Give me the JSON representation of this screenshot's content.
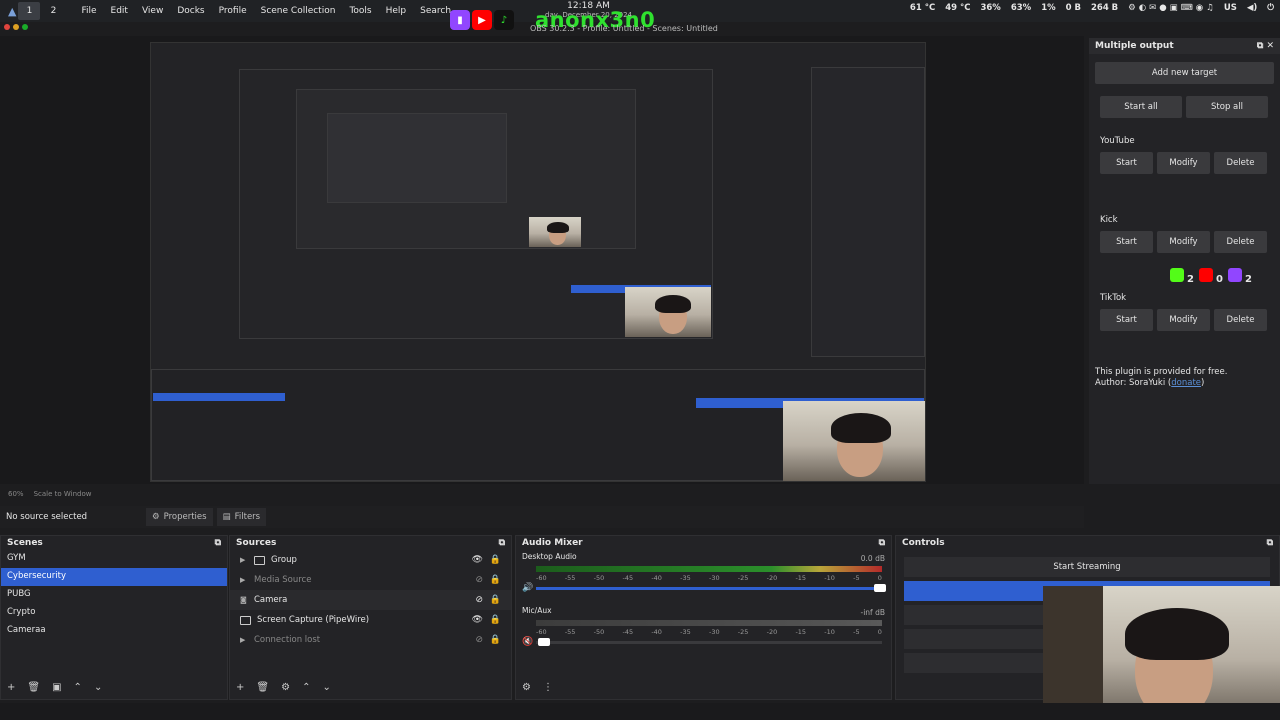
{
  "taskbar": {
    "workspaces": [
      "1",
      "2"
    ],
    "active_workspace": "1",
    "menu": [
      "File",
      "Edit",
      "View",
      "Docks",
      "Profile",
      "Scene Collection",
      "Tools",
      "Help",
      "Search"
    ],
    "clock_time": "12:18 AM",
    "clock_date": "day, December 20, 2024",
    "channel_name": "anonx3n0",
    "window_title": "OBS 30.2.3 - Profile: Untitled - Scenes: Untitled",
    "tray": [
      "61 °C",
      "49 °C",
      "36%",
      "63%",
      "1%",
      "0 B",
      "264 B",
      "US"
    ]
  },
  "scale": {
    "zoom": "60%",
    "mode": "Scale to Window"
  },
  "multiple_output": {
    "title": "Multiple output",
    "add_target": "Add new target",
    "start_all": "Start all",
    "stop_all": "Stop all",
    "targets": [
      {
        "name": "YouTube",
        "start": "Start",
        "modify": "Modify",
        "delete": "Delete"
      },
      {
        "name": "Kick",
        "start": "Start",
        "modify": "Modify",
        "delete": "Delete"
      },
      {
        "name": "TikTok",
        "start": "Start",
        "modify": "Modify",
        "delete": "Delete"
      }
    ],
    "note_line1": "This plugin is provided for free.",
    "note_line2": "Author: SoraYuki (",
    "note_link": "donate",
    "note_end": ")"
  },
  "stream_stats": {
    "kick": "2",
    "youtube": "0",
    "twitch": "2"
  },
  "properties_bar": {
    "no_source": "No source selected",
    "properties": "Properties",
    "filters": "Filters"
  },
  "scenes": {
    "title": "Scenes",
    "items": [
      "GYM",
      "Cybersecurity",
      "PUBG",
      "Crypto",
      "Cameraa"
    ],
    "selected": "Cybersecurity"
  },
  "sources": {
    "title": "Sources",
    "items": [
      {
        "label": "Group"
      },
      {
        "label": "Media Source"
      },
      {
        "label": "Camera"
      },
      {
        "label": "Screen Capture (PipeWire)"
      },
      {
        "label": "Connection lost"
      }
    ]
  },
  "audio_mixer": {
    "title": "Audio Mixer",
    "channels": [
      {
        "name": "Desktop Audio",
        "db": "0.0 dB"
      },
      {
        "name": "Mic/Aux",
        "db": "-inf dB"
      }
    ],
    "ticks": [
      "-60",
      "-55",
      "-50",
      "-45",
      "-40",
      "-35",
      "-30",
      "-25",
      "-20",
      "-15",
      "-10",
      "-5",
      "0"
    ]
  },
  "controls": {
    "title": "Controls",
    "start_streaming": "Start Streaming"
  },
  "colors": {
    "accent": "#2f5fd0",
    "kick": "#53fc18",
    "youtube": "#ff0000",
    "twitch": "#9146ff"
  }
}
